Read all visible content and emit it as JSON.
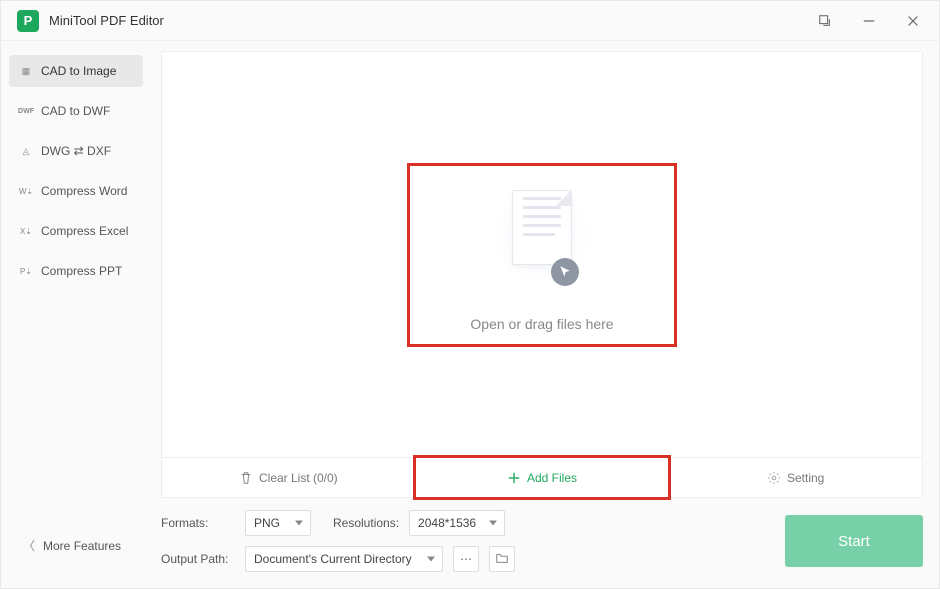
{
  "app": {
    "title": "MiniTool PDF Editor"
  },
  "sidebar": {
    "items": [
      {
        "label": "CAD to Image"
      },
      {
        "label": "CAD to DWF"
      },
      {
        "label": "DWG ⇄ DXF"
      },
      {
        "label": "Compress Word"
      },
      {
        "label": "Compress Excel"
      },
      {
        "label": "Compress PPT"
      }
    ]
  },
  "more_features_label": "More Features",
  "dropzone": {
    "text": "Open or drag files here"
  },
  "toolbar": {
    "clear_list_label": "Clear List (0/0)",
    "add_files_label": "Add Files",
    "setting_label": "Setting"
  },
  "options": {
    "formats_label": "Formats:",
    "format_value": "PNG",
    "resolutions_label": "Resolutions:",
    "resolution_value": "2048*1536",
    "output_path_label": "Output Path:",
    "output_path_value": "Document's Current Directory"
  },
  "start_button_label": "Start"
}
